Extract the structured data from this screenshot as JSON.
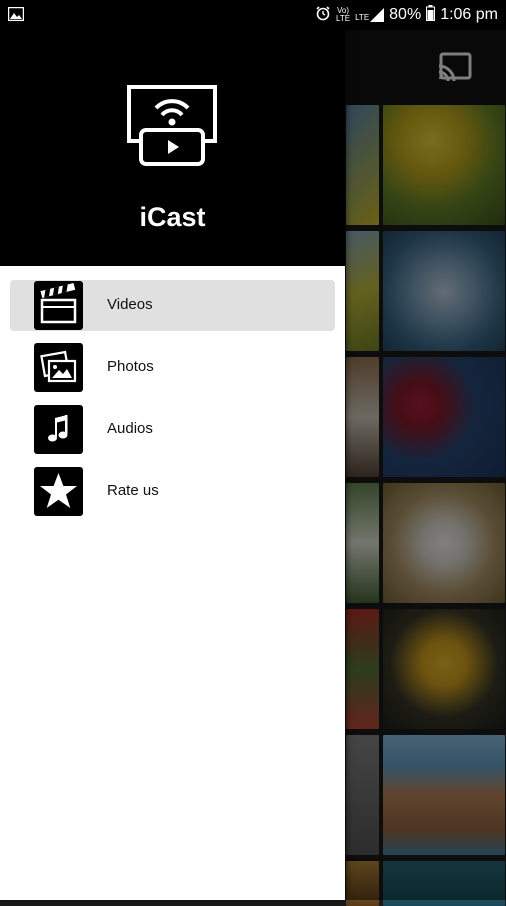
{
  "status_bar": {
    "volte_top": "Vo)",
    "volte_bottom": "LTE",
    "lte_label": "LTE",
    "battery": "80%",
    "time": "1:06 pm"
  },
  "drawer": {
    "app_title": "iCast",
    "items": [
      {
        "label": "Videos",
        "icon": "clapperboard-icon",
        "active": true
      },
      {
        "label": "Photos",
        "icon": "photos-icon",
        "active": false
      },
      {
        "label": "Audios",
        "icon": "music-note-icon",
        "active": false
      },
      {
        "label": "Rate us",
        "icon": "star-icon",
        "active": false
      }
    ]
  },
  "colors": {
    "drawer_header": "#000000",
    "active_item": "#e0e0e0",
    "toolbar": "#121212"
  }
}
